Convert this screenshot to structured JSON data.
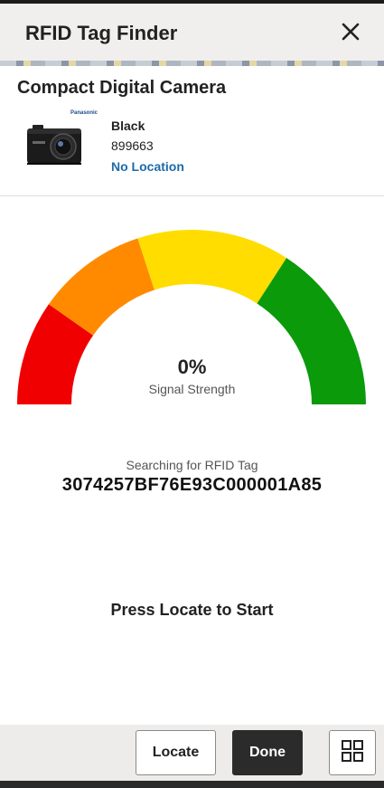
{
  "header": {
    "title": "RFID Tag Finder",
    "close_icon": "close-icon"
  },
  "product": {
    "name": "Compact Digital Camera",
    "brand": "Panasonic",
    "color": "Black",
    "sku": "899663",
    "location": "No Location"
  },
  "gauge": {
    "value_label": "0%",
    "value": 0,
    "caption": "Signal Strength",
    "segment_colors": [
      "#f00000",
      "#ff8a00",
      "#ffdd00",
      "#0a9a0a"
    ]
  },
  "search": {
    "label": "Searching for RFID Tag",
    "tag_id": "3074257BF76E93C000001A85"
  },
  "prompt": "Press Locate to Start",
  "footer": {
    "locate_label": "Locate",
    "done_label": "Done",
    "grid_icon": "grid-icon"
  },
  "colors": {
    "link": "#1e6aa8",
    "dark_button": "#2b2b2b",
    "header_bg": "#f0efed"
  }
}
